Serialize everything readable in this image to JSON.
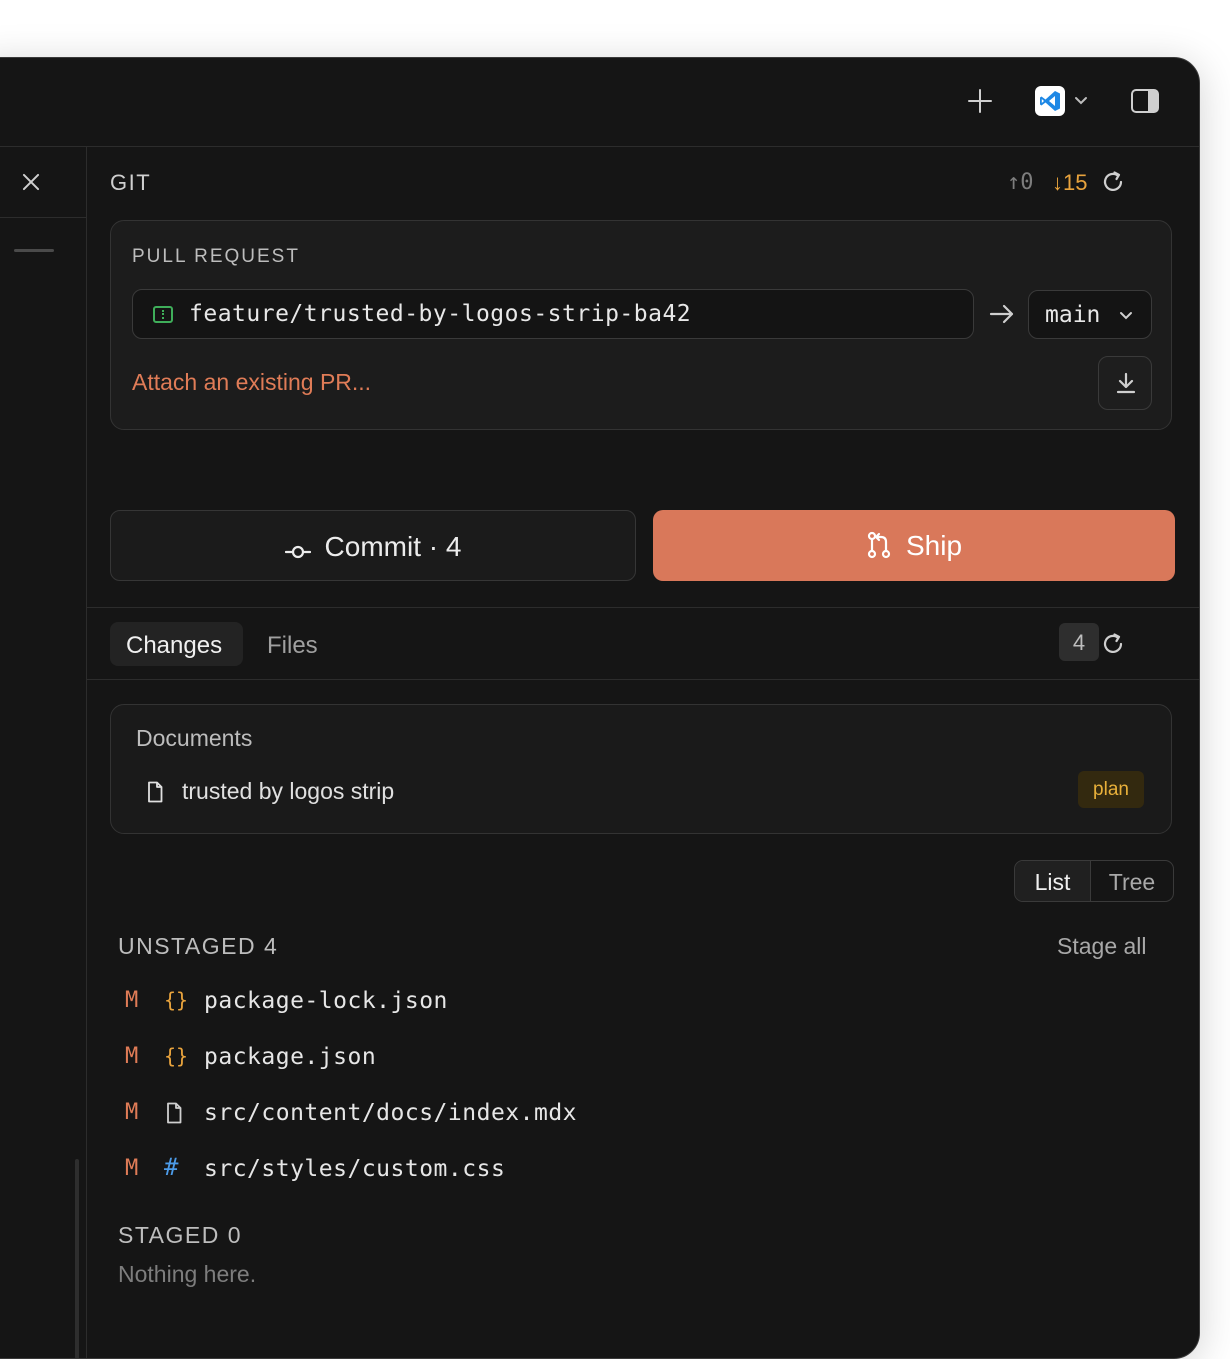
{
  "git": {
    "title": "GIT",
    "ahead": "↑0",
    "behind": "↓15"
  },
  "pull_request": {
    "label": "PULL REQUEST",
    "branch": "feature/trusted-by-logos-strip-ba42",
    "base": "main",
    "attach": "Attach an existing PR..."
  },
  "actions": {
    "commit": "Commit · 4",
    "ship": "Ship"
  },
  "tabs": {
    "changes": "Changes",
    "files": "Files",
    "count": "4"
  },
  "documents": {
    "title": "Documents",
    "items": [
      {
        "name": "trusted by logos strip",
        "badge": "plan"
      }
    ]
  },
  "view_toggle": {
    "list": "List",
    "tree": "Tree"
  },
  "unstaged": {
    "heading": "UNSTAGED 4",
    "stage_all": "Stage all",
    "files": [
      {
        "status": "M",
        "icon": "{}",
        "path": "package-lock.json"
      },
      {
        "status": "M",
        "icon": "{}",
        "path": "package.json"
      },
      {
        "status": "M",
        "icon": "file",
        "path": "src/content/docs/index.mdx"
      },
      {
        "status": "M",
        "icon": "#",
        "path": "src/styles/custom.css"
      }
    ]
  },
  "staged": {
    "heading": "STAGED 0",
    "empty": "Nothing here."
  },
  "colors": {
    "accent": "#d9785a",
    "behind": "#e8a33d",
    "branch_icon": "#3fae5a",
    "css_icon": "#4c9be8"
  }
}
